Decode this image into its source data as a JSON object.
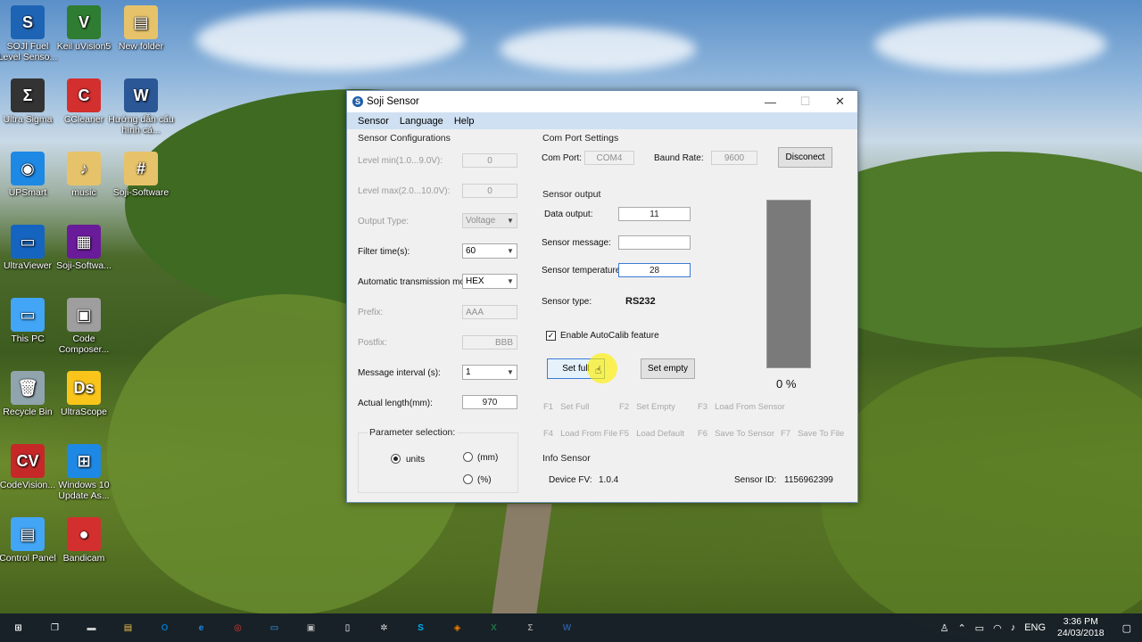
{
  "desktop": {
    "icons": [
      {
        "label": "SOJI Fuel Level Senso...",
        "glyph": "S",
        "color": "#1e64b4"
      },
      {
        "label": "Keil uVision5",
        "glyph": "V",
        "color": "#2e7d32"
      },
      {
        "label": "New folder",
        "glyph": "▤",
        "color": "#e6c36a"
      },
      {
        "label": "Ultra Sigma",
        "glyph": "Σ",
        "color": "#333333"
      },
      {
        "label": "CCleaner",
        "glyph": "C",
        "color": "#d32f2f"
      },
      {
        "label": "Hướng dẫn cấu hình cả...",
        "glyph": "W",
        "color": "#2b5797"
      },
      {
        "label": "UPSmart",
        "glyph": "◉",
        "color": "#1e88e5"
      },
      {
        "label": "music",
        "glyph": "♪",
        "color": "#e6c36a"
      },
      {
        "label": "Soji-Software",
        "glyph": "#",
        "color": "#e6c36a"
      },
      {
        "label": "UltraViewer",
        "glyph": "▭",
        "color": "#1565c0"
      },
      {
        "label": "Soji-Softwa...",
        "glyph": "▦",
        "color": "#6a1b9a"
      },
      {
        "label": "This PC",
        "glyph": "▭",
        "color": "#42a5f5"
      },
      {
        "label": "Code Composer...",
        "glyph": "▣",
        "color": "#9e9e9e"
      },
      {
        "label": "Recycle Bin",
        "glyph": "🗑",
        "color": "#90a4ae"
      },
      {
        "label": "UltraScope",
        "glyph": "Ds",
        "color": "#f9c51b"
      },
      {
        "label": "CodeVision...",
        "glyph": "CV",
        "color": "#c62828"
      },
      {
        "label": "Windows 10 Update As...",
        "glyph": "⊞",
        "color": "#1e88e5"
      },
      {
        "label": "Control Panel",
        "glyph": "▤",
        "color": "#42a5f5"
      },
      {
        "label": "Bandicam",
        "glyph": "●",
        "color": "#d32f2f"
      }
    ]
  },
  "window": {
    "title": "Soji Sensor",
    "icon_glyph": "S",
    "controls": {
      "minimize": "—",
      "maximize": "☐",
      "close": "✕"
    },
    "menu": [
      "Sensor",
      "Language",
      "Help"
    ]
  },
  "sensor_config": {
    "title": "Sensor Configurations",
    "level_min_label": "Level min(1.0...9.0V):",
    "level_min_value": "0",
    "level_max_label": "Level max(2.0...10.0V):",
    "level_max_value": "0",
    "output_type_label": "Output Type:",
    "output_type_value": "Voltage",
    "filter_time_label": "Filter time(s):",
    "filter_time_value": "60",
    "auto_mode_label": "Automatic transmission mode:",
    "auto_mode_value": "HEX",
    "prefix_label": "Prefix:",
    "prefix_value": "AAA",
    "postfix_label": "Postfix:",
    "postfix_value": "BBB",
    "msg_interval_label": "Message interval (s):",
    "msg_interval_value": "1",
    "actual_length_label": "Actual length(mm):",
    "actual_length_value": "970",
    "param_title": "Parameter selection:",
    "param_units": "units",
    "param_mm": "(mm)",
    "param_pct": "(%)"
  },
  "com_port": {
    "title": "Com Port Settings",
    "port_label": "Com Port:",
    "port_value": "COM4",
    "baud_label": "Baund Rate:",
    "baud_value": "9600",
    "disconnect_label": "Disconect"
  },
  "sensor_output": {
    "title": "Sensor output",
    "data_output_label": "Data output:",
    "data_output_value": "11",
    "message_label": "Sensor message:",
    "message_value": "",
    "temperature_label": "Sensor temperature:",
    "temperature_value": "28",
    "type_label": "Sensor type:",
    "type_value": "RS232",
    "autocalib_label": "Enable AutoCalib feature",
    "autocalib_checked": true,
    "set_full_label": "Set full",
    "set_empty_label": "Set empty",
    "level_percent_text": "0 %",
    "level_fraction": 0.0
  },
  "fkeys": [
    {
      "key": "F1",
      "label": "Set Full"
    },
    {
      "key": "F2",
      "label": "Set Empty"
    },
    {
      "key": "F3",
      "label": "Load From Sensor"
    },
    {
      "key": "F4",
      "label": "Load From File"
    },
    {
      "key": "F5",
      "label": "Load Default"
    },
    {
      "key": "F6",
      "label": "Save To Sensor"
    },
    {
      "key": "F7",
      "label": "Save To File"
    }
  ],
  "info_sensor": {
    "title": "Info Sensor",
    "fw_label": "Device FV:",
    "fw_value": "1.0.4",
    "id_label": "Sensor ID:",
    "id_value": "1156962399"
  },
  "taskbar": {
    "apps": [
      {
        "name": "start-icon",
        "glyph": "⊞",
        "color": "#ffffff"
      },
      {
        "name": "task-view-icon",
        "glyph": "❐",
        "color": "#ffffff"
      },
      {
        "name": "usb-icon",
        "glyph": "▬",
        "color": "#cccccc"
      },
      {
        "name": "file-explorer-icon",
        "glyph": "▤",
        "color": "#f2c14e"
      },
      {
        "name": "outlook-icon",
        "glyph": "O",
        "color": "#0072c6"
      },
      {
        "name": "edge-icon",
        "glyph": "e",
        "color": "#1e88e5"
      },
      {
        "name": "chrome-icon",
        "glyph": "◎",
        "color": "#e53935"
      },
      {
        "name": "window-app-icon",
        "glyph": "▭",
        "color": "#42a5f5"
      },
      {
        "name": "terminal-icon",
        "glyph": "▣",
        "color": "#bbbbbb"
      },
      {
        "name": "notepad-icon",
        "glyph": "▯",
        "color": "#ffffff"
      },
      {
        "name": "network-tool-icon",
        "glyph": "✲",
        "color": "#dddddd"
      },
      {
        "name": "skype-icon",
        "glyph": "S",
        "color": "#00aff0"
      },
      {
        "name": "orange-app-icon",
        "glyph": "◈",
        "color": "#f57c00"
      },
      {
        "name": "excel-icon",
        "glyph": "X",
        "color": "#217346"
      },
      {
        "name": "ultra-sigma-icon",
        "glyph": "Σ",
        "color": "#999999"
      },
      {
        "name": "word-icon",
        "glyph": "W",
        "color": "#2b5797"
      }
    ],
    "language": "ENG",
    "time": "3:36 PM",
    "date": "24/03/2018"
  }
}
